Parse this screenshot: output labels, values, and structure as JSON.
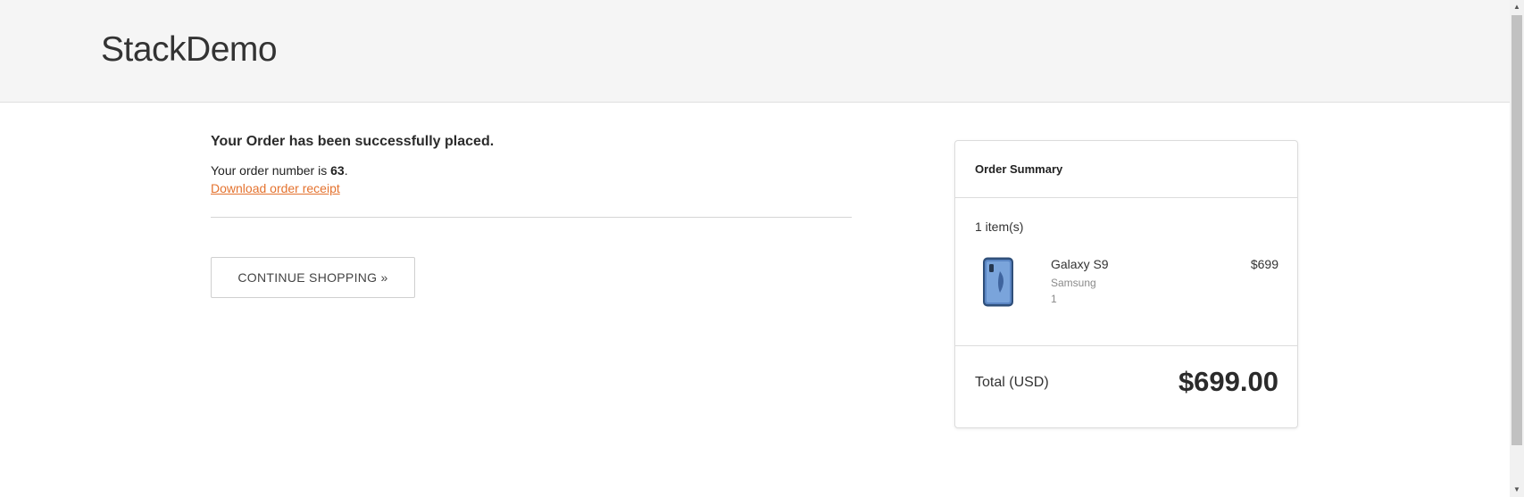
{
  "header": {
    "logo": "StackDemo"
  },
  "confirmation": {
    "title": "Your Order has been successfully placed.",
    "order_prefix": "Your order number is ",
    "order_number": "63",
    "order_suffix": ".",
    "receipt_link": "Download order receipt",
    "continue_label": "CONTINUE SHOPPING »"
  },
  "summary": {
    "title": "Order Summary",
    "items_count": "1 item(s)",
    "items": [
      {
        "name": "Galaxy S9",
        "brand": "Samsung",
        "quantity": "1",
        "price": "$699",
        "image_icon": "phone-icon"
      }
    ],
    "total_label": "Total (USD)",
    "total_value": "$699.00"
  },
  "colors": {
    "accent_link": "#e4722e",
    "header_bg": "#f5f5f5",
    "text": "#333333"
  }
}
